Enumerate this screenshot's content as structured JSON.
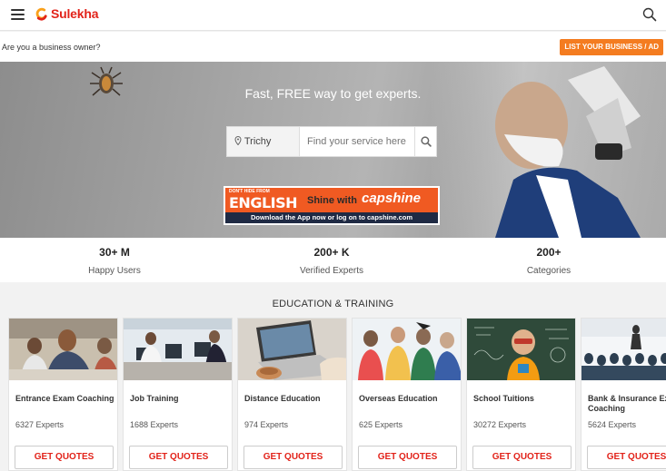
{
  "header": {
    "brand": "Sulekha",
    "menu_icon": "hamburger-menu-icon",
    "search_icon": "search-icon",
    "brand_color": "#e2231a"
  },
  "business_bar": {
    "question": "Are you a business owner?",
    "cta": "LIST YOUR BUSINESS / AD",
    "cta_color": "#f47c20"
  },
  "hero": {
    "title": "Fast, FREE way to get experts.",
    "location": "Trichy",
    "search_placeholder": "Find your service here",
    "banner": {
      "small_text": "DON'T HIDE FROM",
      "big_text": "ENGLISH",
      "shine": "Shine with",
      "brand": "capshine",
      "bottom": "Download the App now or log on to capshine.com"
    }
  },
  "stats": [
    {
      "value": "30+ M",
      "label": "Happy Users"
    },
    {
      "value": "200+ K",
      "label": "Verified Experts"
    },
    {
      "value": "200+",
      "label": "Categories"
    }
  ],
  "education": {
    "heading": "EDUCATION & TRAINING",
    "cards": [
      {
        "title": "Entrance Exam Coaching",
        "experts": "6327 Experts",
        "cta": "GET QUOTES"
      },
      {
        "title": "Job Training",
        "experts": "1688 Experts",
        "cta": "GET QUOTES"
      },
      {
        "title": "Distance Education",
        "experts": "974 Experts",
        "cta": "GET QUOTES"
      },
      {
        "title": "Overseas Education",
        "experts": "625 Experts",
        "cta": "GET QUOTES"
      },
      {
        "title": "School Tuitions",
        "experts": "30272 Experts",
        "cta": "GET QUOTES"
      },
      {
        "title": "Bank & Insurance Exam Coaching",
        "experts": "5624 Experts",
        "cta": "GET QUOTES"
      }
    ]
  }
}
